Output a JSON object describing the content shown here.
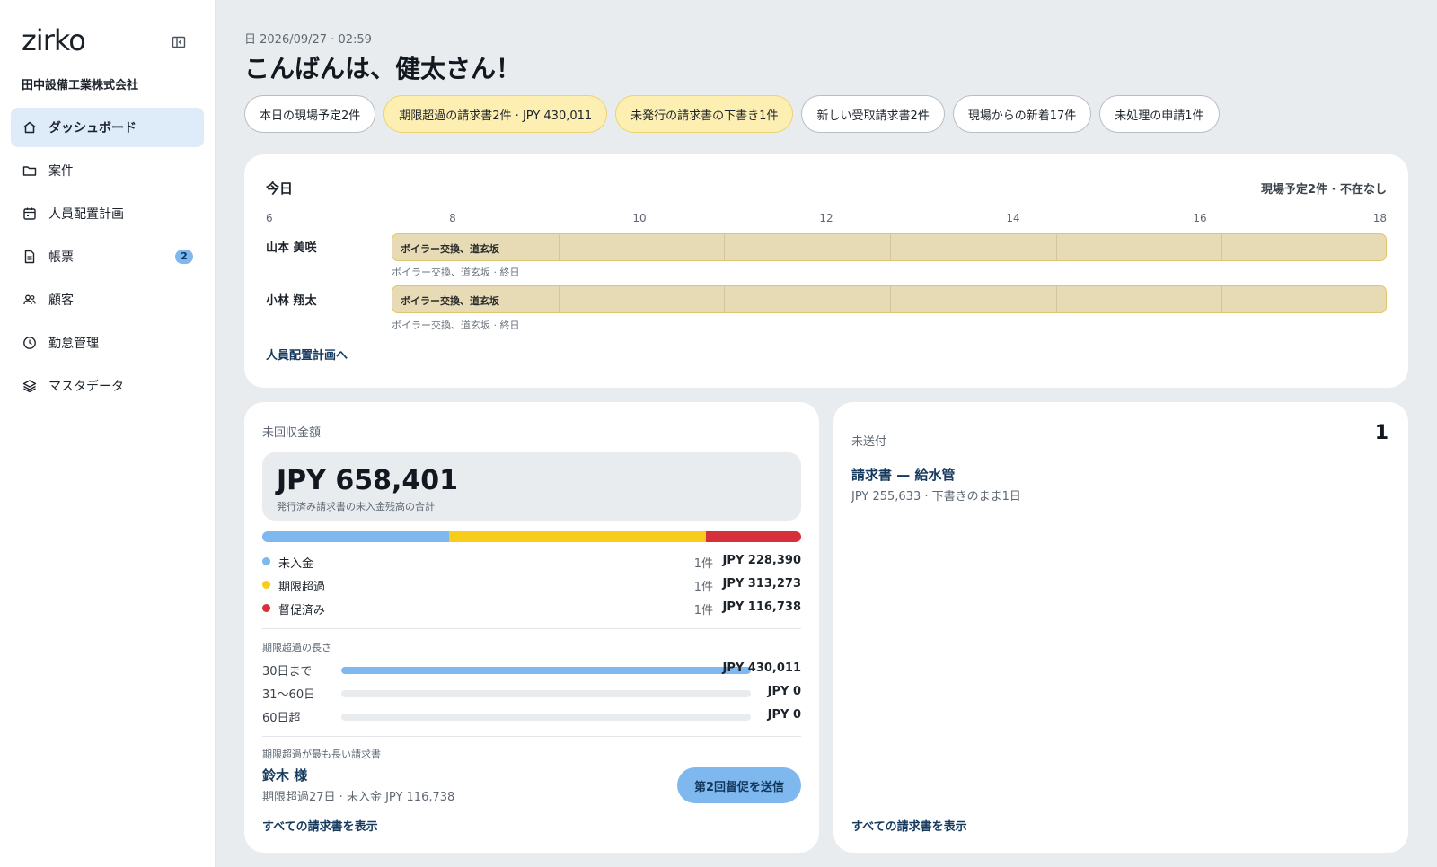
{
  "sidebar": {
    "logo": "zirko",
    "company": "田中設備工業株式会社",
    "items": [
      {
        "label": "ダッシュボード",
        "icon": "home-icon",
        "active": true
      },
      {
        "label": "案件",
        "icon": "folder-icon"
      },
      {
        "label": "人員配置計画",
        "icon": "calendar-icon"
      },
      {
        "label": "帳票",
        "icon": "document-icon",
        "badge": "2"
      },
      {
        "label": "顧客",
        "icon": "users-icon"
      },
      {
        "label": "勤怠管理",
        "icon": "clock-icon"
      },
      {
        "label": "マスタデータ",
        "icon": "layers-icon"
      }
    ]
  },
  "header": {
    "date": "日 2026/09/27 · 02:59",
    "greeting": "こんばんは、健太さん！"
  },
  "pills": [
    {
      "label": "本日の現場予定2件",
      "warn": false
    },
    {
      "label": "期限超過の請求書2件 · JPY 430,011",
      "warn": true
    },
    {
      "label": "未発行の請求書の下書き1件",
      "warn": true
    },
    {
      "label": "新しい受取請求書2件",
      "warn": false
    },
    {
      "label": "現場からの新着17件",
      "warn": false
    },
    {
      "label": "未処理の申請1件",
      "warn": false
    }
  ],
  "today": {
    "title": "今日",
    "summary": "現場予定2件 · 不在なし",
    "hours": [
      "6",
      "8",
      "10",
      "12",
      "14",
      "16",
      "18"
    ],
    "hour_start": 6,
    "hour_end": 18,
    "rows": [
      {
        "name": "山本 美咲",
        "job": "ボイラー交換、道玄坂",
        "sub": "ボイラー交換、道玄坂 · 終日",
        "start": 7.5,
        "end": 18
      },
      {
        "name": "小林 翔太",
        "job": "ボイラー交換、道玄坂",
        "sub": "ボイラー交換、道玄坂 · 終日",
        "start": 7.5,
        "end": 18
      }
    ],
    "link": "人員配置計画へ"
  },
  "receivables": {
    "label": "未回収金額",
    "total": "JPY 658,401",
    "total_sub": "発行済み請求書の未入金残高の合計",
    "segments": [
      {
        "name": "未入金",
        "count": "1件",
        "amount": "JPY 228,390",
        "value": 228390,
        "color": "#7eb8ef"
      },
      {
        "name": "期限超過",
        "count": "1件",
        "amount": "JPY 313,273",
        "value": 313273,
        "color": "#f7cc1b"
      },
      {
        "name": "督促済み",
        "count": "1件",
        "amount": "JPY 116,738",
        "value": 116738,
        "color": "#d6303a"
      }
    ],
    "aging_title": "期限超過の長さ",
    "aging": [
      {
        "name": "30日まで",
        "amount": "JPY 430,011",
        "value": 430011
      },
      {
        "name": "31〜60日",
        "amount": "JPY 0",
        "value": 0
      },
      {
        "name": "60日超",
        "amount": "JPY 0",
        "value": 0
      }
    ],
    "longest_title": "期限超過が最も長い請求書",
    "longest_customer": "鈴木 様",
    "longest_sub": "期限超過27日 · 未入金 JPY 116,738",
    "remind_button": "第2回督促を送信",
    "link": "すべての請求書を表示"
  },
  "unsent": {
    "label": "未送付",
    "count": "1",
    "invoice_title": "請求書 — 給水管",
    "invoice_sub": "JPY 255,633 · 下書きのまま1日",
    "link": "すべての請求書を表示"
  }
}
